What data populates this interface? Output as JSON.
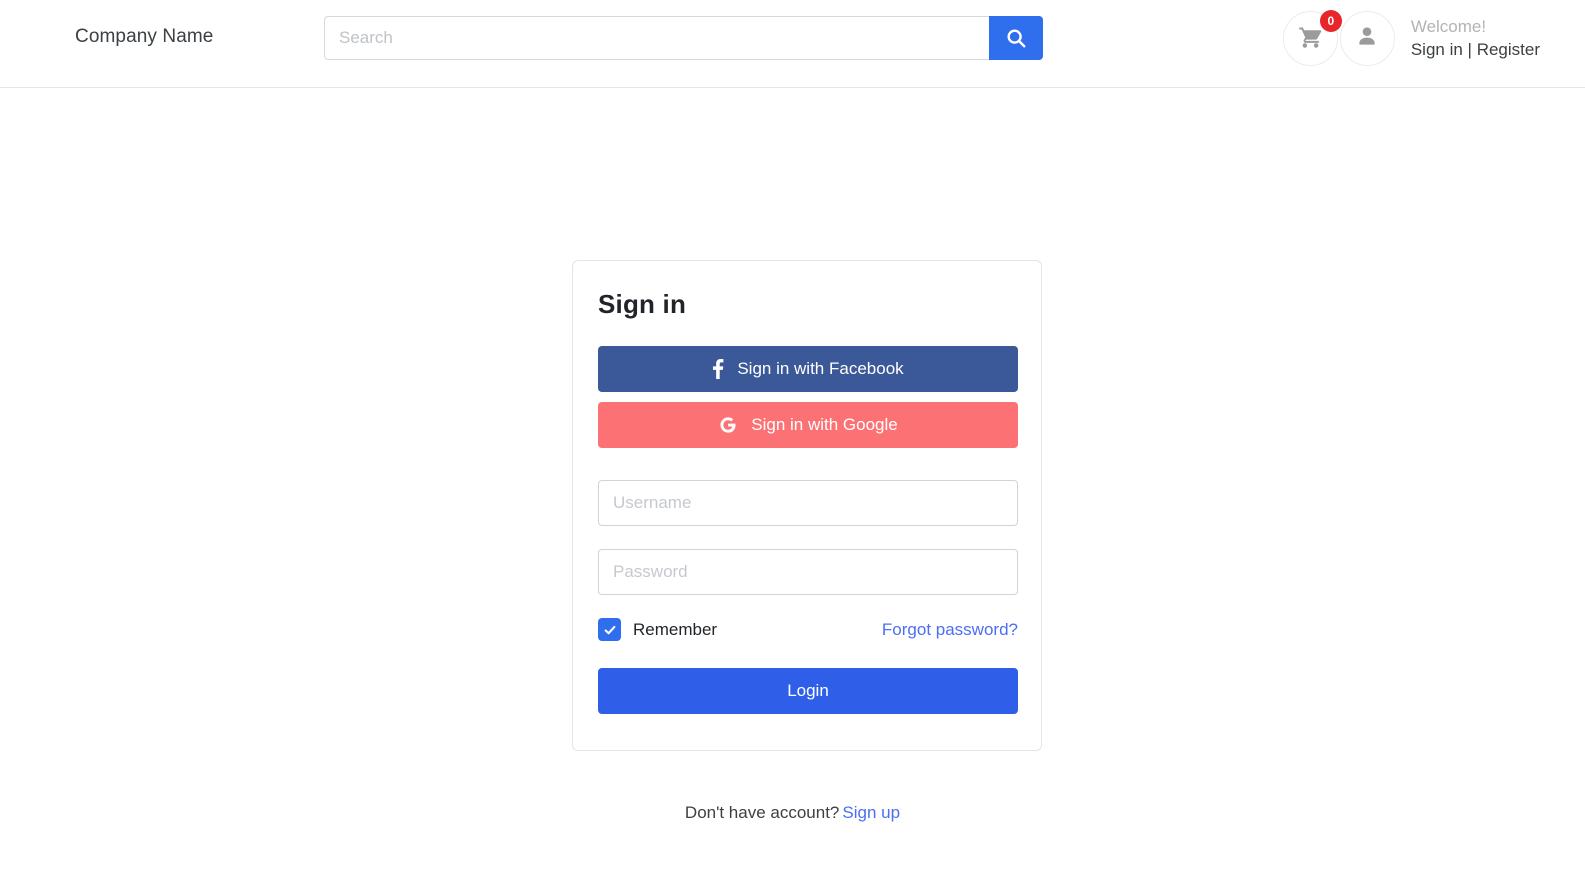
{
  "header": {
    "brand": "Company Name",
    "search": {
      "placeholder": "Search",
      "value": "",
      "button_icon": "search-icon"
    },
    "cart": {
      "icon": "shopping-cart-icon",
      "badge_count": "0"
    },
    "account": {
      "icon": "user-avatar-icon",
      "welcome": "Welcome!",
      "sign_in": "Sign in",
      "separator": " | ",
      "register": "Register"
    }
  },
  "login_card": {
    "title": "Sign in",
    "facebook_button": {
      "label": "Sign in with Facebook",
      "icon": "facebook-icon",
      "color": "#3b5998"
    },
    "google_button": {
      "label": "Sign in with Google",
      "icon": "google-icon",
      "color": "#fc7274"
    },
    "username": {
      "placeholder": "Username",
      "value": ""
    },
    "password": {
      "placeholder": "Password",
      "value": ""
    },
    "remember": {
      "label": "Remember",
      "checked": true,
      "color": "#2f6fed"
    },
    "forgot_password": "Forgot password?",
    "login_button": {
      "label": "Login",
      "color": "#2f5fe8"
    }
  },
  "footer": {
    "no_account_text": "Don't have account?",
    "sign_up": "Sign up"
  },
  "colors": {
    "accent_blue": "#2f6fed",
    "link_blue": "#4b6ef5",
    "badge_red": "#e8252a",
    "facebook_blue": "#3b5998",
    "google_red": "#fc7274"
  }
}
